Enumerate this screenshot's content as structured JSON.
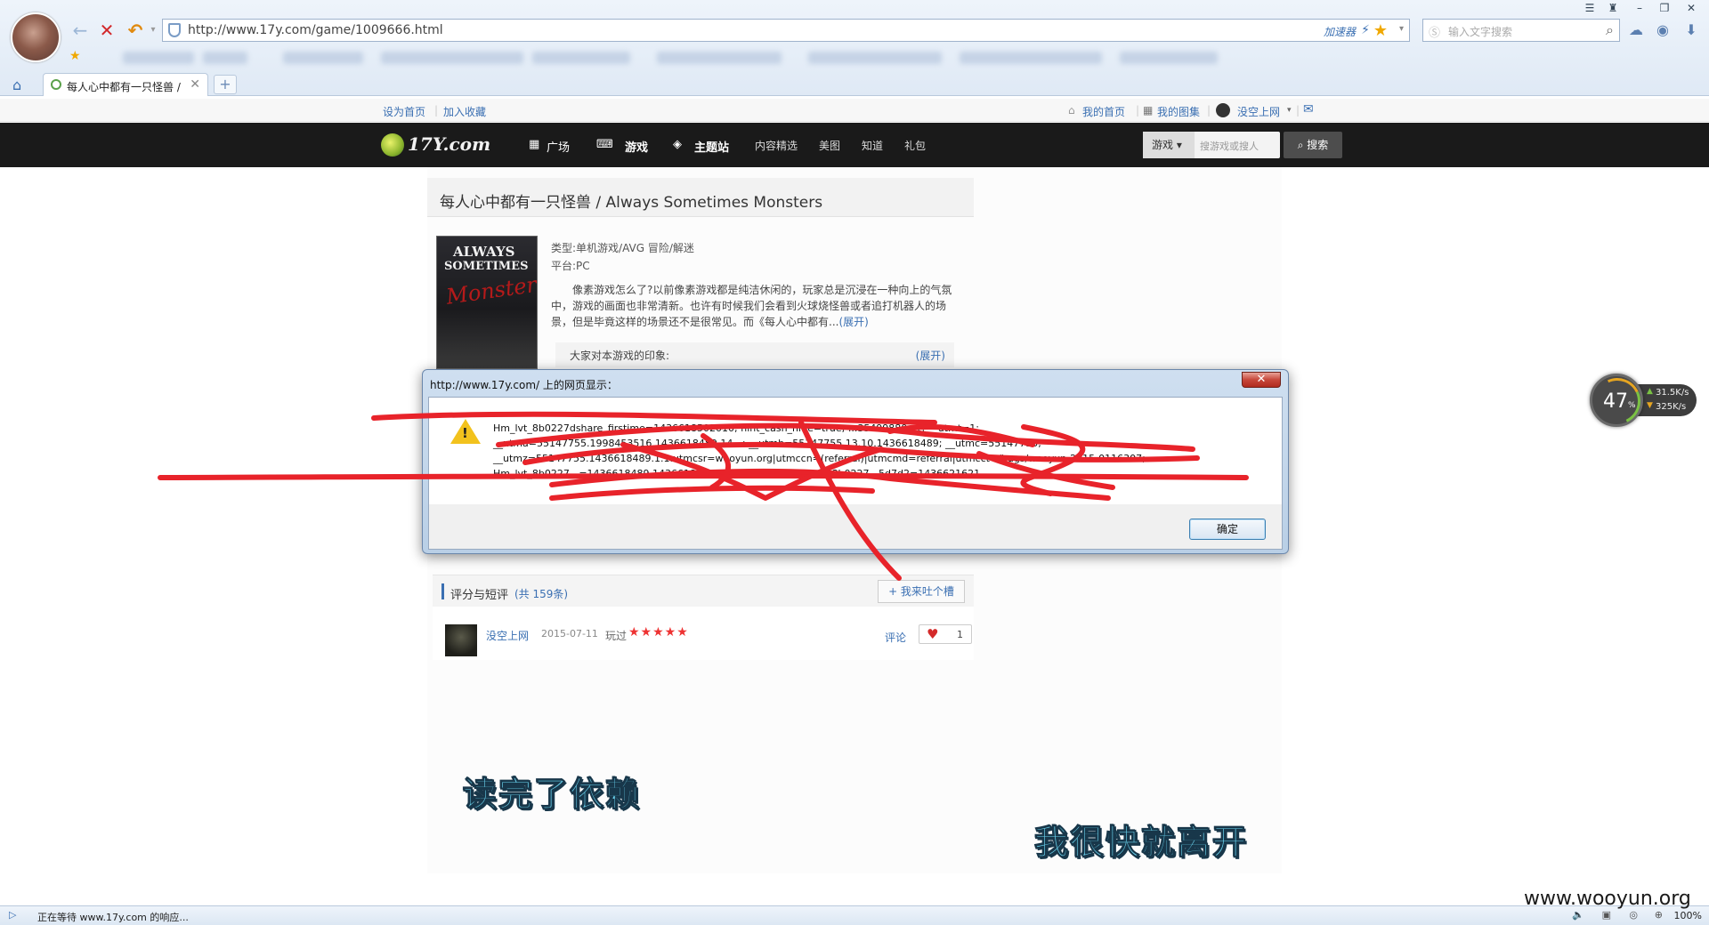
{
  "browser": {
    "url": "http://www.17y.com/game/1009666.html",
    "accelerator_label": "加速器",
    "search_placeholder": "输入文字搜索",
    "tab_title": "每人心中都有一只怪兽 /",
    "status_text": "正在等待 www.17y.com 的响应...",
    "zoom_level": "100%"
  },
  "site_links": {
    "set_home": "设为首页",
    "add_favorite": "加入收藏",
    "my_home": "我的首页",
    "my_album": "我的图集",
    "username": "没空上网",
    "mail_icon": "mail-icon"
  },
  "site_nav": {
    "logo_text": "17Y.com",
    "items": [
      "广场",
      "游戏",
      "主题站",
      "内容精选",
      "美图",
      "知道",
      "礼包"
    ],
    "search_category": "游戏",
    "search_placeholder": "搜游戏或搜人",
    "search_button": "搜索"
  },
  "game": {
    "title": "每人心中都有一只怪兽 / Always Sometimes Monsters",
    "cover_lines": [
      "ALWAYS",
      "SOMETIMES",
      "Monsters"
    ],
    "type": "类型:单机游戏/AVG 冒险/解迷",
    "platform": "平台:PC",
    "description": "像素游戏怎么了?以前像素游戏都是纯洁休闲的，玩家总是沉浸在一种向上的气氛中，游戏的画面也非常清新。也许有时候我们会看到火球烧怪兽或者追打机器人的场景，但是毕竟这样的场景还不是很常见。而《每人心中都有...",
    "description_more": "(展开)",
    "impression_label": "大家对本游戏的印象:",
    "impression_expand": "(展开)"
  },
  "reviews": {
    "title": "评分与短评",
    "count": "(共 159条)",
    "add_button": "+ 我来吐个槽",
    "items": [
      {
        "user": "没空上网",
        "date": "2015-07-11",
        "played": "玩过",
        "stars": "★★★★★",
        "comment_link": "评论",
        "likes": "1"
      }
    ]
  },
  "dialog": {
    "title": "http://www.17y.com/ 上的网页显示：",
    "lines": [
      "Hm_lvt_8b0227dshare_firstime=1436618502010; hint_cash_hide=true; ...35499880=1; __utmt=1;",
      "__utma=55147755.1998453516.1436618489.14...; __utmb=55147755.13.10.1436618489; __utmc=55147755;",
      "__utmz=55147755.1436618489.1.1.utmcsr=wooyun.org|utmccn=(referral)|utmcmd=referral|utmcct=/bugs/wooyun-2015-0116307;",
      "Hm_lvt_8b0227...=1436618489,1436618544,1436618852; Hm_lpvt_8b0227...5d7d2=1436621621"
    ],
    "ok_button": "确定"
  },
  "captions": {
    "line1": "读完了依赖",
    "line2": "我很快就离开"
  },
  "speed_widget": {
    "percent": "47",
    "upload": "31.5K/s",
    "download": "325K/s"
  },
  "watermark": "www.wooyun.org"
}
